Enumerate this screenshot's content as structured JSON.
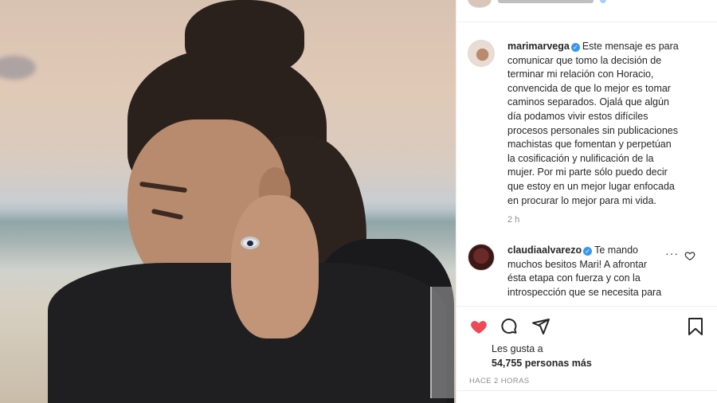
{
  "post": {
    "caption": {
      "username": "marimarvega",
      "text": "Este mensaje es para\ncomunicar que tomo la decisión de\nterminar mi relación con Horacio,\nconvencida de que lo mejor es tomar\ncaminos separados. Ojalá que algún\ndía podamos vivir estos difíciles\nprocesos personales sin publicaciones\nmachistas que fomentan y perpetúan\nla cosificación y nulificación de la\nmujer. Por mi parte sólo puedo decir\nque estoy en un mejor lugar enfocada\nen procurar lo mejor para mi vida.",
      "time": "2 h"
    },
    "reply": {
      "username": "claudiaalvarezo",
      "text": "Te mando\nmuchos besitos Mari! A afrontar\nésta etapa con fuerza y con la\nintrospección que se necesita para\ntomar grandes decisiones! Te quiero",
      "more": "···"
    },
    "likes": {
      "label": "Les gusta a",
      "count": "54,755 personas más"
    },
    "posted_ago": "HACE 2 HORAS"
  },
  "icons": {
    "like": "heart-filled-icon",
    "comment": "comment-bubble-icon",
    "share": "paper-plane-icon",
    "save": "bookmark-icon",
    "verified": "verified-badge-icon",
    "reply_like": "heart-outline-icon"
  },
  "colors": {
    "like_red": "#ed4956",
    "verified_blue": "#3897f0",
    "muted_text": "#8e8e8e"
  }
}
